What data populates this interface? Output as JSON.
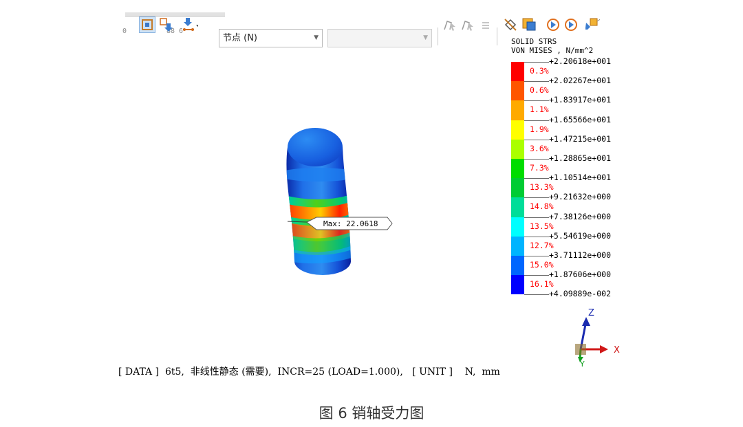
{
  "toolbar": {
    "node_select_value": "节点 (N)",
    "empty_select_value": "",
    "small_labels": {
      "left_zero": "0",
      "mid_label": "88 6"
    },
    "icons": [
      "fit-view-icon",
      "shrink-icon",
      "deform-icon",
      "node-tool-icon",
      "probe-icon",
      "probe-alt-icon",
      "align-icon",
      "cross-section-icon",
      "max-label-icon",
      "play-left-icon",
      "play-right-icon",
      "edit-icon"
    ]
  },
  "legend": {
    "title_line1": "SOLID STRS",
    "title_line2": "VON MISES , N/mm^2",
    "values": [
      "+2.20618e+001",
      "+2.02267e+001",
      "+1.83917e+001",
      "+1.65566e+001",
      "+1.47215e+001",
      "+1.28865e+001",
      "+1.10514e+001",
      "+9.21632e+000",
      "+7.38126e+000",
      "+5.54619e+000",
      "+3.71112e+000",
      "+1.87606e+000",
      "+4.09889e-002"
    ],
    "percentages": [
      "0.3%",
      "0.6%",
      "1.1%",
      "1.9%",
      "3.6%",
      "7.3%",
      "13.3%",
      "14.8%",
      "13.5%",
      "12.7%",
      "15.0%",
      "16.1%"
    ],
    "colors": [
      "#ff0000",
      "#ff5500",
      "#ffaa00",
      "#ffff00",
      "#aaff00",
      "#00dd00",
      "#00cc33",
      "#00dd99",
      "#00ffff",
      "#00b4ff",
      "#0066ff",
      "#0000ff"
    ]
  },
  "model": {
    "max_label": "Max: 22.0618"
  },
  "axes": {
    "z": "Z",
    "x": "X",
    "y": "Y"
  },
  "status": "[ DATA ]  6t5,  非线性静态 (需要),  INCR=25 (LOAD=1.000),   [ UNIT ]    N,  mm",
  "caption": "图 6 销轴受力图"
}
